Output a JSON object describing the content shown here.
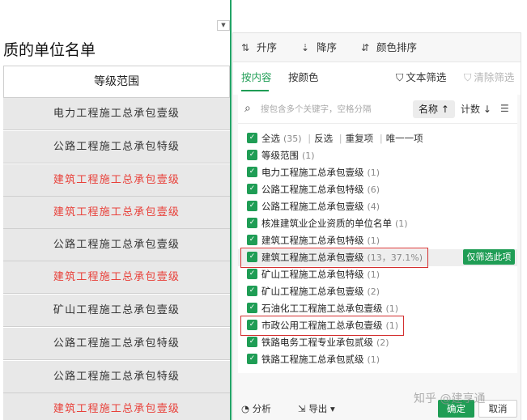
{
  "sheet": {
    "title": "质的单位名单",
    "header": "等级范围",
    "rows": [
      {
        "text": "电力工程施工总承包壹级",
        "color": "#333333"
      },
      {
        "text": "公路工程施工总承包特级",
        "color": "#333333"
      },
      {
        "text": "建筑工程施工总承包壹级",
        "color": "#e8413a"
      },
      {
        "text": "建筑工程施工总承包壹级",
        "color": "#e8413a"
      },
      {
        "text": "公路工程施工总承包壹级",
        "color": "#333333"
      },
      {
        "text": "建筑工程施工总承包壹级",
        "color": "#e8413a"
      },
      {
        "text": "矿山工程施工总承包壹级",
        "color": "#333333"
      },
      {
        "text": "公路工程施工总承包特级",
        "color": "#333333"
      },
      {
        "text": "公路工程施工总承包特级",
        "color": "#333333"
      },
      {
        "text": "建筑工程施工总承包壹级",
        "color": "#e8413a"
      }
    ]
  },
  "filter": {
    "sort": {
      "asc": "升序",
      "desc": "降序",
      "by_color": "颜色排序"
    },
    "tabs": {
      "content": "按内容",
      "color": "按颜色"
    },
    "text_filter": "文本筛选",
    "clear_filter": "清除筛选",
    "search_placeholder": "搜包含多个关键字，空格分隔",
    "sort_name": "名称",
    "sort_count": "计数",
    "select_all": {
      "label": "全选",
      "count": "(35)"
    },
    "ops": {
      "invert": "反选",
      "duplicates": "重复项",
      "unique": "唯一一项"
    },
    "items": [
      {
        "label": "等级范围",
        "count": "(1)"
      },
      {
        "label": "电力工程施工总承包壹级",
        "count": "(1)"
      },
      {
        "label": "公路工程施工总承包特级",
        "count": "(6)"
      },
      {
        "label": "公路工程施工总承包壹级",
        "count": "(4)"
      },
      {
        "label": "核准建筑业企业资质的单位名单",
        "count": "(1)"
      },
      {
        "label": "建筑工程施工总承包特级",
        "count": "(1)"
      },
      {
        "label": "建筑工程施工总承包壹级",
        "count": "(13，37.1%)"
      },
      {
        "label": "矿山工程施工总承包特级",
        "count": "(1)"
      },
      {
        "label": "矿山工程施工总承包壹级",
        "count": "(2)"
      },
      {
        "label": "石油化工工程施工总承包壹级",
        "count": "(1)"
      },
      {
        "label": "市政公用工程施工总承包壹级",
        "count": "(1)"
      },
      {
        "label": "铁路电务工程专业承包贰级",
        "count": "(2)"
      },
      {
        "label": "铁路工程施工总承包贰级",
        "count": "(1)"
      }
    ],
    "only_this": "仅筛选此项",
    "footer": {
      "analyze": "分析",
      "export": "导出",
      "ok": "确定",
      "cancel": "取消"
    }
  },
  "watermark": "知乎 @建享通",
  "colors": {
    "accent": "#1f9d55",
    "highlight_box": "#d32f2f",
    "red_text": "#e8413a"
  }
}
